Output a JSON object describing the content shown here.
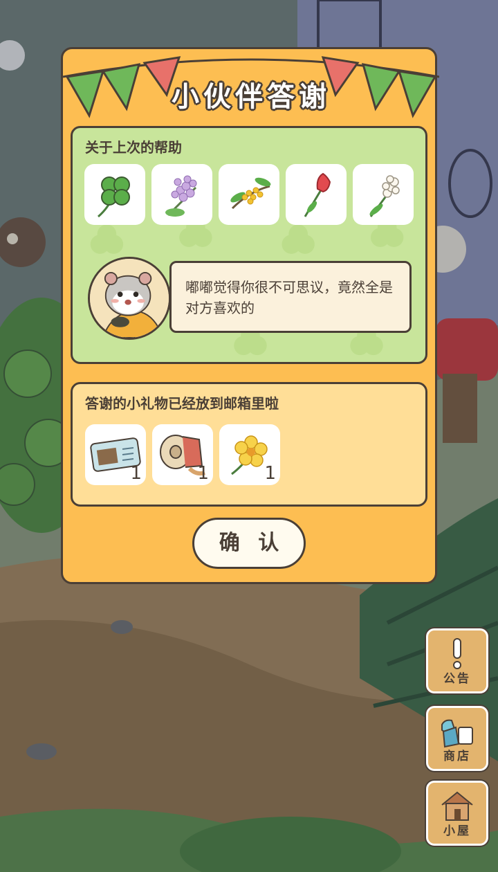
{
  "dialog": {
    "title": "小伙伴答谢",
    "help_section": {
      "title": "关于上次的帮助",
      "items": [
        "four-leaf-clover-icon",
        "lilac-icon",
        "osmanthus-icon",
        "tulip-icon",
        "hyacinth-icon"
      ],
      "message": "嘟嘟觉得你很不可思议，竟然全是对方喜欢的"
    },
    "gift_section": {
      "title": "答谢的小礼物已经放到邮箱里啦",
      "gifts": [
        {
          "icon": "ticket-icon",
          "qty": "1"
        },
        {
          "icon": "fabric-roll-icon",
          "qty": "1"
        },
        {
          "icon": "yellow-flower-icon",
          "qty": "1"
        }
      ]
    },
    "confirm_label": "确 认"
  },
  "side_menu": {
    "notice": "公告",
    "shop": "商店",
    "house": "小屋"
  },
  "colors": {
    "dialog_bg": "#FDBE52",
    "help_panel_bg": "#C8E59B",
    "gift_panel_bg": "#FFDE97",
    "outline": "#4a3f36",
    "side_button_bg": "#E3B46E"
  }
}
